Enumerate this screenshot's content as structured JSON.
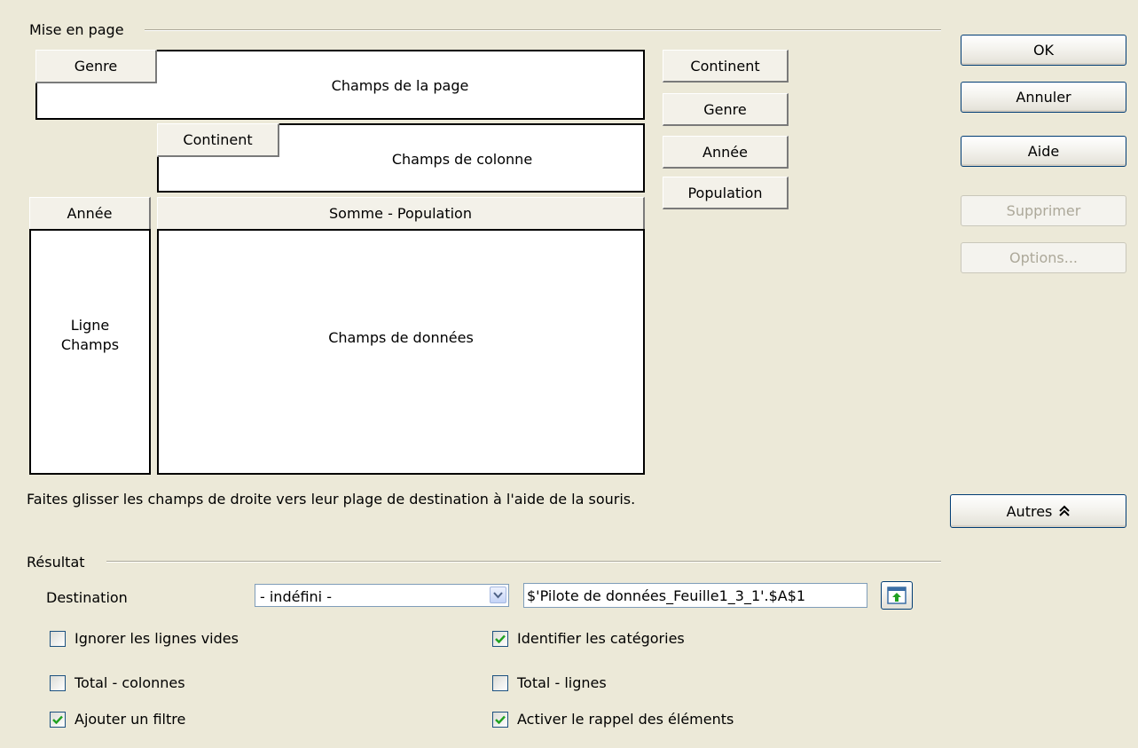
{
  "layout": {
    "section_title": "Mise en page",
    "page_area": {
      "label": "Champs de la page",
      "fields": [
        "Genre"
      ]
    },
    "column_area": {
      "label": "Champs de colonne",
      "fields": [
        "Continent"
      ]
    },
    "row_area": {
      "label_line1": "Ligne",
      "label_line2": "Champs",
      "fields": [
        "Année"
      ]
    },
    "data_area": {
      "label": "Champs de données",
      "fields": [
        "Somme - Population"
      ]
    },
    "available_fields": [
      "Continent",
      "Genre",
      "Année",
      "Population"
    ],
    "hint": "Faites glisser les champs de droite vers leur plage de destination à l'aide de la souris."
  },
  "buttons": {
    "ok": "OK",
    "cancel": "Annuler",
    "help": "Aide",
    "delete": "Supprimer",
    "options": "Options...",
    "more": "Autres"
  },
  "result": {
    "section_title": "Résultat",
    "destination_label": "Destination",
    "destination_select": "- indéfini -",
    "destination_ref": "$'Pilote de données_Feuille1_3_1'.$A$1",
    "options": {
      "ignore_empty_rows": {
        "label": "Ignorer les lignes vides",
        "checked": false
      },
      "identify_categories": {
        "label": "Identifier les catégories",
        "checked": true
      },
      "total_columns": {
        "label": "Total - colonnes",
        "checked": false
      },
      "total_rows": {
        "label": "Total - lignes",
        "checked": false
      },
      "add_filter": {
        "label": "Ajouter un filtre",
        "checked": true
      },
      "enable_drilldown": {
        "label": "Activer le rappel des éléments",
        "checked": true
      }
    }
  },
  "colors": {
    "dialog_bg": "#ece9d8",
    "check_mark": "#21a121",
    "button_border": "#003c74",
    "disabled_text": "#aca899"
  }
}
